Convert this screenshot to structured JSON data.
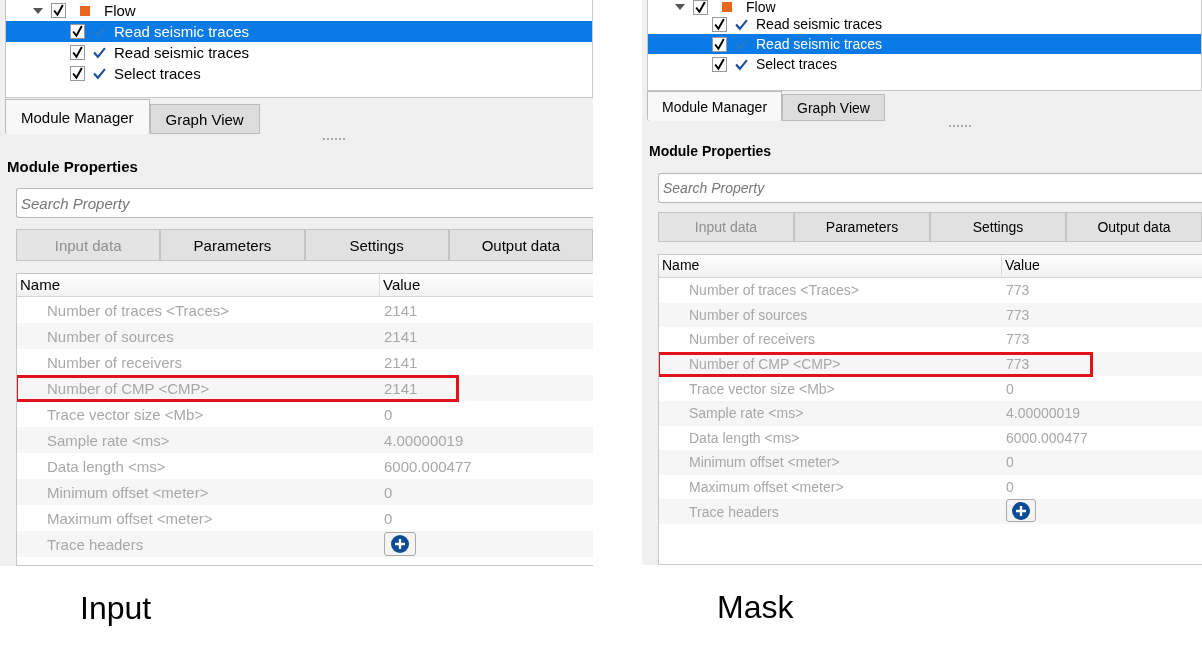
{
  "panels": [
    {
      "caption": "Input",
      "tree": {
        "label": "Flow",
        "expanded": true,
        "checked": true,
        "children": [
          {
            "label": "Read seismic traces",
            "checked": true,
            "selected": true
          },
          {
            "label": "Read seismic traces",
            "checked": true,
            "selected": false
          },
          {
            "label": "Select traces",
            "checked": true,
            "selected": false
          }
        ]
      },
      "view_tabs": [
        {
          "label": "Module Manager",
          "selected": true
        },
        {
          "label": "Graph View",
          "selected": false
        }
      ],
      "heading": "Module Properties",
      "search": {
        "placeholder": "Search Property"
      },
      "property_tabs": [
        {
          "label": "Input data",
          "disabled": true
        },
        {
          "label": "Parameters",
          "disabled": false
        },
        {
          "label": "Settings",
          "disabled": false
        },
        {
          "label": "Output data",
          "disabled": false
        }
      ],
      "table": {
        "columns": [
          "Name",
          "Value"
        ],
        "rows": [
          {
            "kind": "text",
            "name": "Number of traces <Traces>",
            "value": "2141",
            "highlighted": false
          },
          {
            "kind": "text",
            "name": "Number of sources",
            "value": "2141",
            "highlighted": false
          },
          {
            "kind": "text",
            "name": "Number of receivers",
            "value": "2141",
            "highlighted": false
          },
          {
            "kind": "text",
            "name": "Number of CMP <CMP>",
            "value": "2141",
            "highlighted": true
          },
          {
            "kind": "text",
            "name": "Trace vector size <Mb>",
            "value": "0",
            "highlighted": false
          },
          {
            "kind": "text",
            "name": "Sample rate <ms>",
            "value": "4.00000019",
            "highlighted": false
          },
          {
            "kind": "text",
            "name": "Data length <ms>",
            "value": "6000.000477",
            "highlighted": false
          },
          {
            "kind": "text",
            "name": "Minimum offset <meter>",
            "value": "0",
            "highlighted": false
          },
          {
            "kind": "text",
            "name": "Maximum offset <meter>",
            "value": "0",
            "highlighted": false
          },
          {
            "kind": "add",
            "name": "Trace headers",
            "highlighted": false
          }
        ]
      }
    },
    {
      "caption": "Mask",
      "tree": {
        "label": "Flow",
        "expanded": true,
        "checked": true,
        "children": [
          {
            "label": "Read seismic traces",
            "checked": true,
            "selected": false
          },
          {
            "label": "Read seismic traces",
            "checked": true,
            "selected": true
          },
          {
            "label": "Select traces",
            "checked": true,
            "selected": false
          }
        ]
      },
      "view_tabs": [
        {
          "label": "Module Manager",
          "selected": true
        },
        {
          "label": "Graph View",
          "selected": false
        }
      ],
      "heading": "Module Properties",
      "search": {
        "placeholder": "Search Property"
      },
      "property_tabs": [
        {
          "label": "Input data",
          "disabled": true
        },
        {
          "label": "Parameters",
          "disabled": false
        },
        {
          "label": "Settings",
          "disabled": false
        },
        {
          "label": "Output data",
          "disabled": false
        }
      ],
      "table": {
        "columns": [
          "Name",
          "Value"
        ],
        "rows": [
          {
            "kind": "text",
            "name": "Number of traces <Traces>",
            "value": "773",
            "highlighted": false
          },
          {
            "kind": "text",
            "name": "Number of sources",
            "value": "773",
            "highlighted": false
          },
          {
            "kind": "text",
            "name": "Number of receivers",
            "value": "773",
            "highlighted": false
          },
          {
            "kind": "text",
            "name": "Number of CMP <CMP>",
            "value": "773",
            "highlighted": true
          },
          {
            "kind": "text",
            "name": "Trace vector size <Mb>",
            "value": "0",
            "highlighted": false
          },
          {
            "kind": "text",
            "name": "Sample rate <ms>",
            "value": "4.00000019",
            "highlighted": false
          },
          {
            "kind": "text",
            "name": "Data length <ms>",
            "value": "6000.000477",
            "highlighted": false
          },
          {
            "kind": "text",
            "name": "Minimum offset <meter>",
            "value": "0",
            "highlighted": false
          },
          {
            "kind": "text",
            "name": "Maximum offset <meter>",
            "value": "0",
            "highlighted": false
          },
          {
            "kind": "add",
            "name": "Trace headers",
            "highlighted": false
          }
        ]
      }
    }
  ]
}
